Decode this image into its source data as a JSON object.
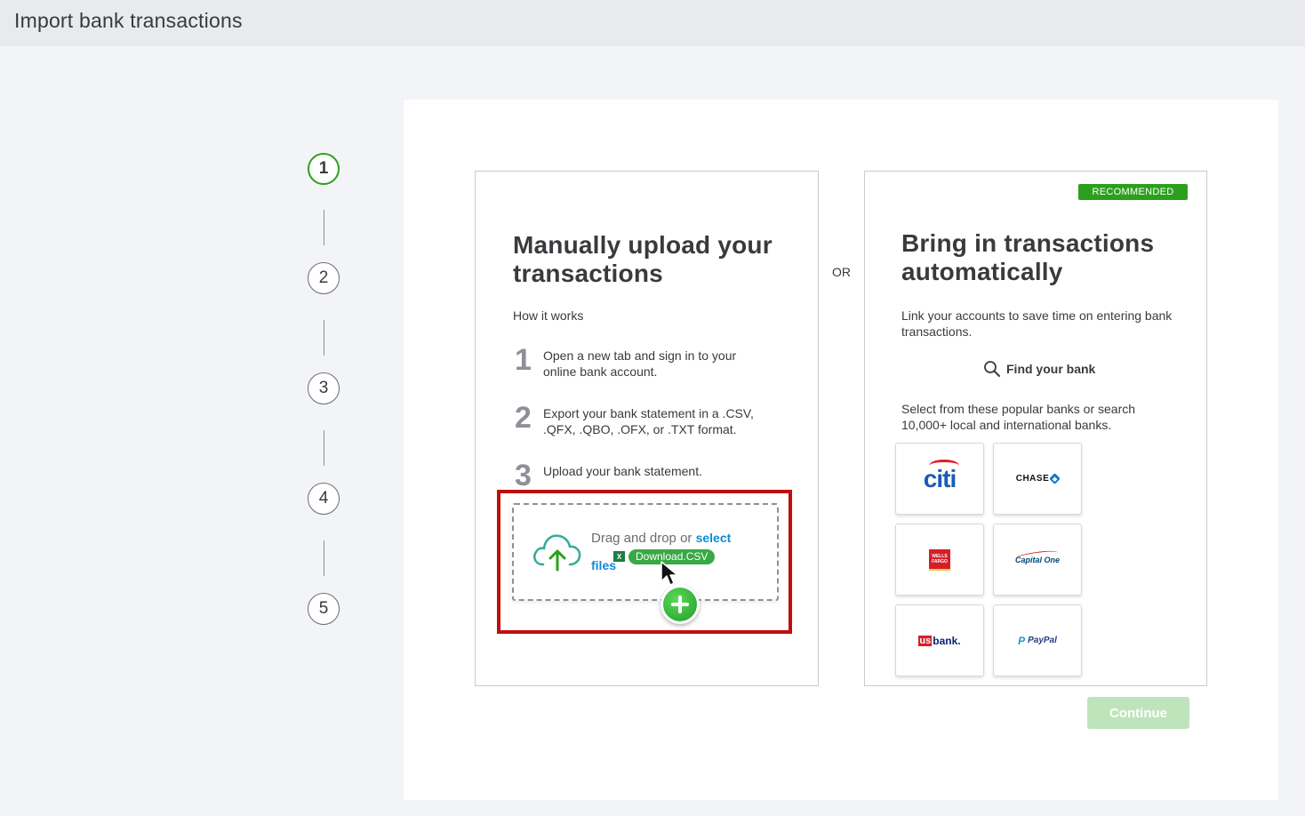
{
  "header": {
    "title": "Import bank transactions"
  },
  "stepper": {
    "steps": [
      "1",
      "2",
      "3",
      "4",
      "5"
    ],
    "active": 1
  },
  "or_label": "OR",
  "manual": {
    "title": "Manually upload your transactions",
    "how_label": "How it works",
    "steps": [
      {
        "num": "1",
        "text": "Open a new tab and sign in to your online bank account."
      },
      {
        "num": "2",
        "text": "Export your bank statement in a .CSV, .QFX, .QBO, .OFX, or .TXT format."
      },
      {
        "num": "3",
        "text": "Upload your bank statement."
      }
    ],
    "dropzone": {
      "text": "Drag and drop or",
      "link": "select",
      "link2": "files",
      "drag_file": "Download.CSV",
      "excel_glyph": "X"
    }
  },
  "auto": {
    "badge": "RECOMMENDED",
    "title": "Bring in transactions automatically",
    "desc": "Link your accounts to save time on entering bank transactions.",
    "find_bank": "Find your bank",
    "select_desc": "Select from these popular banks or search 10,000+ local and international banks.",
    "banks": {
      "citi": "citi",
      "chase": "CHASE",
      "wells_fargo_1": "WELLS",
      "wells_fargo_2": "FARGO",
      "capital_one": "Capital One",
      "usbank_us": "us",
      "usbank_bank": "bank.",
      "paypal_p": "P",
      "paypal": "PayPal"
    }
  },
  "continue_label": "Continue",
  "colors": {
    "accent": "#2ca01c",
    "link": "#0d8bd6",
    "highlight": "#c00d0d"
  }
}
